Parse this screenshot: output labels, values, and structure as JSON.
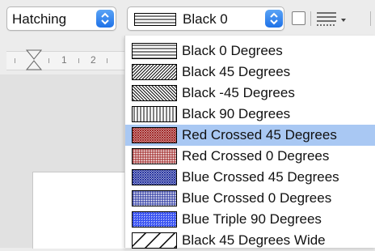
{
  "toolbar": {
    "area_style_select": {
      "value": "Hatching"
    },
    "hatch_select": {
      "value": "Black 0"
    }
  },
  "dropdown": {
    "items": [
      {
        "label": "Black 0 Degrees",
        "pattern": "horizontal",
        "color": "#000000"
      },
      {
        "label": "Black 45 Degrees",
        "pattern": "diag45",
        "color": "#000000"
      },
      {
        "label": "Black -45 Degrees",
        "pattern": "diagm45",
        "color": "#000000"
      },
      {
        "label": "Black 90 Degrees",
        "pattern": "vertical",
        "color": "#000000"
      },
      {
        "label": "Red Crossed 45 Degrees",
        "pattern": "cross45",
        "color": "#9b1c1c",
        "selected": true
      },
      {
        "label": "Red Crossed 0 Degrees",
        "pattern": "cross0",
        "color": "#9b1c1c"
      },
      {
        "label": "Blue Crossed 45 Degrees",
        "pattern": "cross45",
        "color": "#1c2a9b"
      },
      {
        "label": "Blue Crossed 0 Degrees",
        "pattern": "cross0",
        "color": "#1c2a9b"
      },
      {
        "label": "Blue Triple 90 Degrees",
        "pattern": "triple",
        "color": "#1f3cf0"
      },
      {
        "label": "Black 45 Degrees Wide",
        "pattern": "wide45",
        "color": "#000000"
      }
    ]
  },
  "ruler": {
    "numbers": [
      "1",
      "2"
    ]
  },
  "colors": {
    "accent": "#1f72e8",
    "selection": "#a9c8f3"
  }
}
